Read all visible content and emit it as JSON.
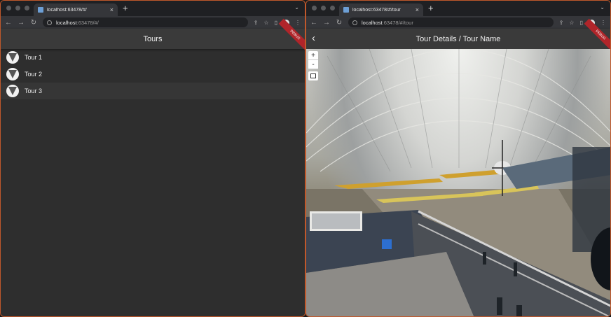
{
  "left": {
    "tab_title": "localhost:63478/#/",
    "url_host": "localhost",
    "url_path": ":63478/#/",
    "app_title": "Tours",
    "debug_banner": "DEBUG",
    "tours": [
      {
        "label": "Tour 1"
      },
      {
        "label": "Tour 2"
      },
      {
        "label": "Tour 3"
      }
    ]
  },
  "right": {
    "tab_title": "localhost:63478/#/tour",
    "url_host": "localhost",
    "url_path": ":63478/#/tour",
    "app_title": "Tour Details / Tour Name",
    "debug_banner": "DEBUG",
    "zoom_in": "+",
    "zoom_out": "-"
  },
  "colors": {
    "window_border": "#c0582b",
    "appbar": "#3a3a3a",
    "list_bg": "#2e2e2e",
    "debug": "#b0252a"
  }
}
